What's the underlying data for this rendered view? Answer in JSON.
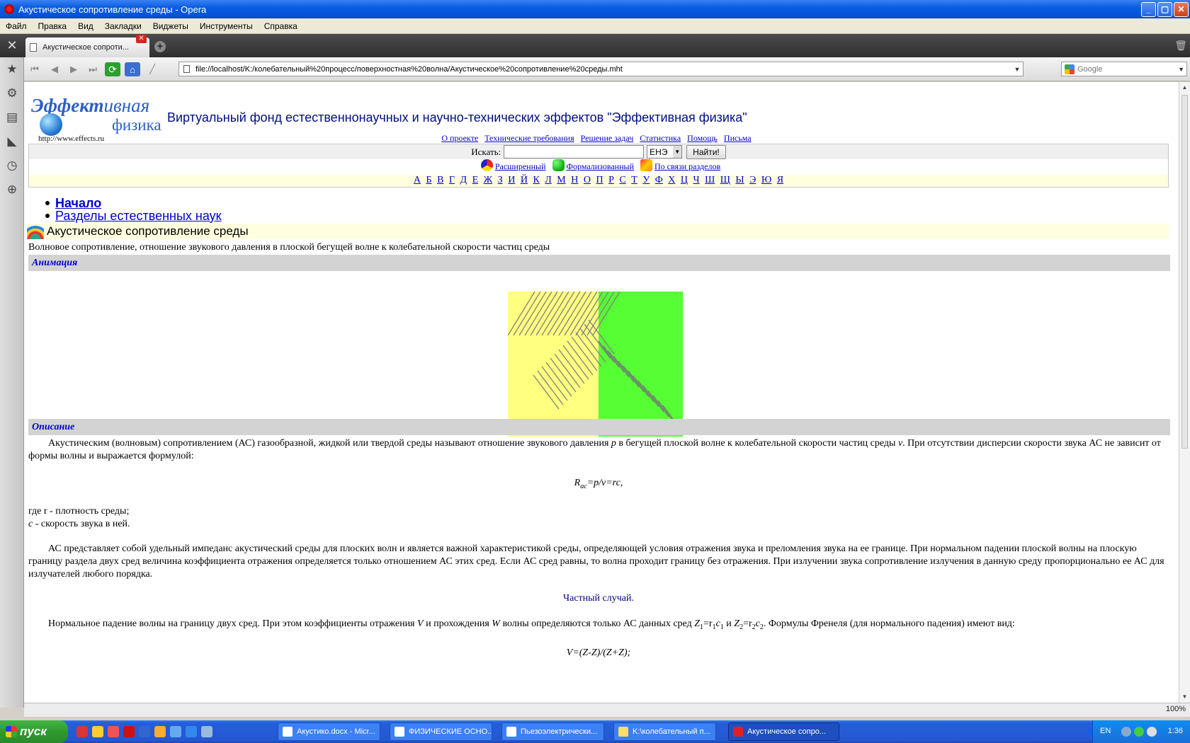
{
  "window": {
    "title": "Акустическое сопротивление среды - Opera",
    "buttons": {
      "minimize": "_",
      "maximize": "▢",
      "close": "✕"
    }
  },
  "menu": [
    "Файл",
    "Правка",
    "Вид",
    "Закладки",
    "Виджеты",
    "Инструменты",
    "Справка"
  ],
  "tab": {
    "label": "Акустическое сопроти...",
    "close": "✕",
    "new": "+"
  },
  "address": {
    "url": "file://localhost/K:/колебательный%20процесс/поверхностная%20волна/Акустическое%20сопротивление%20среды.mht",
    "search_placeholder": "Google"
  },
  "page": {
    "logo": {
      "line1_bold": "Эффект",
      "line1_rest": "ивная",
      "line2": "физика",
      "url": "http://www.effects.ru"
    },
    "site_title": "Виртуальный фонд естественнонаучных и научно-технических эффектов \"Эффективная физика\"",
    "top_links": [
      "О проекте",
      "Технические требования",
      "Решение задач",
      "Статистика",
      "Помощь",
      "Письма"
    ],
    "search": {
      "label": "Искать:",
      "select": "ЕНЭ",
      "button": "Найти!"
    },
    "adv_links": [
      "Расширенный",
      "Формализованный",
      "По связи разделов"
    ],
    "alphabet": [
      "А",
      "Б",
      "В",
      "Г",
      "Д",
      "Е",
      "Ж",
      "З",
      "И",
      "Й",
      "К",
      "Л",
      "М",
      "Н",
      "О",
      "П",
      "Р",
      "С",
      "Т",
      "У",
      "Ф",
      "Х",
      "Ц",
      "Ч",
      "Ш",
      "Щ",
      "Ы",
      "Э",
      "Ю",
      "Я"
    ],
    "breadcrumbs": [
      "Начало",
      "Разделы естественных наук"
    ],
    "entry_title": "Акустическое сопротивление среды",
    "entry_desc": "Волновое сопротивление, отношение звукового давления в плоской бегущей волне к колебательной скорости частиц среды",
    "section_animation": "Анимация",
    "section_description": "Описание",
    "p1": "Акустическим (волновым) сопротивлением (АС) газообразной, жидкой или твердой среды называют отношение звукового давления",
    "p1_var_p": "p",
    "p1_mid": "в бегущей плоской волне к колебательной скорости частиц среды",
    "p1_var_v": "v",
    "p1_end": ". При отсутствии дисперсии скорости звука АС не зависит от формы волны и выражается формулой:",
    "formula1_R": "R",
    "formula1_sub": "ac",
    "formula1_rest": "=p/v=rc,",
    "where1": "где r - плотность среды;",
    "where2_var": "c",
    "where2": " - скорость звука в ней.",
    "p2": "АС представляет собой удельный импеданс акустический среды для плоских волн и является важной характеристикой среды, определяющей условия отражения звука и преломления звука на ее границе. При нормальном падении плоской волны на плоскую границу раздела двух сред величина коэффициента отражения определяется только отношением АС этих сред. Если АС сред равны, то волна проходит границу без отражения. При излучении звука сопротивление излучения в данную среду пропорционально ее АС для излучателей любого порядка.",
    "special_case": "Частный случай.",
    "p3_start": "Нормальное падение волны на границу двух сред. При этом коэффициенты отражения",
    "p3_V": "V",
    "p3_mid": "и прохождения",
    "p3_W": "W",
    "p3_mid2": "волны определяются только АС данных сред",
    "p3_z1": "Z",
    "p3_z1_rest": "=r",
    "p3_z2": "Z",
    "p3_z2_rest": "=r",
    "p3_end": ". Формулы Френеля (для нормального падения) имеют вид:",
    "formula2": "V=(Z-Z)/(Z+Z);"
  },
  "status": {
    "zoom": "100%"
  },
  "taskbar": {
    "start": "пуск",
    "items": [
      "Акустико.docx - Micr...",
      "ФИЗИЧЕСКИЕ ОСНО...",
      "Пьезоэлектрически...",
      "K:\\колебательный п...",
      "Акустическое сопро..."
    ],
    "lang": "EN",
    "clock": "1:36"
  },
  "colors": {
    "link": "#0000cc",
    "section_bg": "#d3d3d3",
    "section_text": "#0000c8",
    "anim_left": "#ffff80",
    "anim_right": "#55ff33"
  }
}
